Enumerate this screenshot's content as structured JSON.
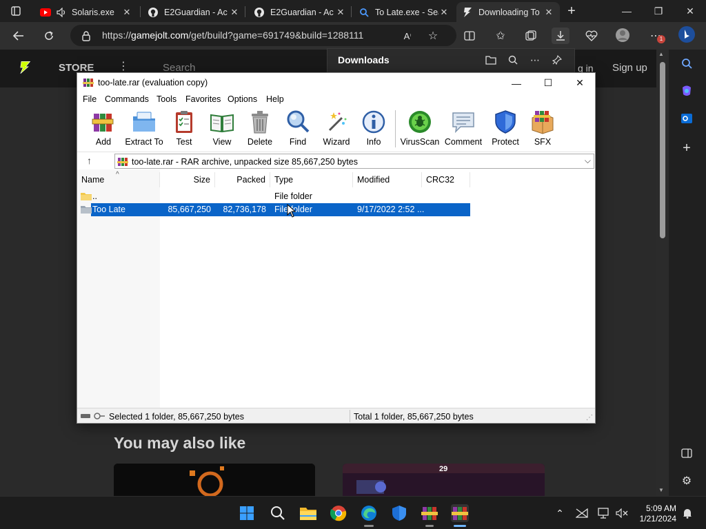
{
  "browser": {
    "tabs": [
      {
        "label": "Solaris.exe",
        "favicon": "youtube-icon",
        "muted_audio": true
      },
      {
        "label": "E2Guardian - Ac",
        "favicon": "github-icon"
      },
      {
        "label": "E2Guardian - Ac",
        "favicon": "github-icon"
      },
      {
        "label": "To Late.exe - Sea",
        "favicon": "search-icon"
      },
      {
        "label": "Downloading To",
        "favicon": "gamejolt-icon",
        "active": true
      }
    ],
    "new_tab_symbol": "+",
    "url_prefix": "https://",
    "url_host": "gamejolt.com",
    "url_path": "/get/build?game=691749&build=1288111",
    "accent_color": "#3b82f6"
  },
  "site": {
    "nav_store": "STORE",
    "search_placeholder": "Search",
    "login_fragment": "g in",
    "signup": "Sign up",
    "section_heading": "You may also like",
    "thumb2_text": "29"
  },
  "downloads_panel": {
    "title": "Downloads"
  },
  "winrar": {
    "title": "too-late.rar (evaluation copy)",
    "menu": [
      "File",
      "Commands",
      "Tools",
      "Favorites",
      "Options",
      "Help"
    ],
    "tools": [
      {
        "label": "Add",
        "icon": "add-archive-icon"
      },
      {
        "label": "Extract To",
        "icon": "extract-folder-icon"
      },
      {
        "label": "Test",
        "icon": "test-clipboard-icon"
      },
      {
        "label": "View",
        "icon": "view-book-icon"
      },
      {
        "label": "Delete",
        "icon": "trash-icon"
      },
      {
        "label": "Find",
        "icon": "magnifier-icon"
      },
      {
        "label": "Wizard",
        "icon": "magic-wand-icon"
      },
      {
        "label": "Info",
        "icon": "info-icon"
      },
      {
        "label": "VirusScan",
        "icon": "virus-scan-icon"
      },
      {
        "label": "Comment",
        "icon": "comment-icon"
      },
      {
        "label": "Protect",
        "icon": "shield-icon"
      },
      {
        "label": "SFX",
        "icon": "sfx-box-icon"
      }
    ],
    "path_text": "too-late.rar - RAR archive, unpacked size 85,667,250 bytes",
    "columns": [
      "Name",
      "Size",
      "Packed",
      "Type",
      "Modified",
      "CRC32"
    ],
    "rows": [
      {
        "name": "..",
        "size": "",
        "packed": "",
        "type": "File folder",
        "modified": "",
        "crc": ""
      },
      {
        "name": "Too Late",
        "size": "85,667,250",
        "packed": "82,736,178",
        "type": "File folder",
        "modified": "9/17/2022 2:52 ...",
        "crc": "",
        "selected": true
      }
    ],
    "status_left": "Selected 1 folder, 85,667,250 bytes",
    "status_right": "Total 1 folder, 85,667,250 bytes",
    "selection_color": "#0a64c8"
  },
  "taskbar": {
    "time": "5:09 AM",
    "date": "1/21/2024"
  }
}
